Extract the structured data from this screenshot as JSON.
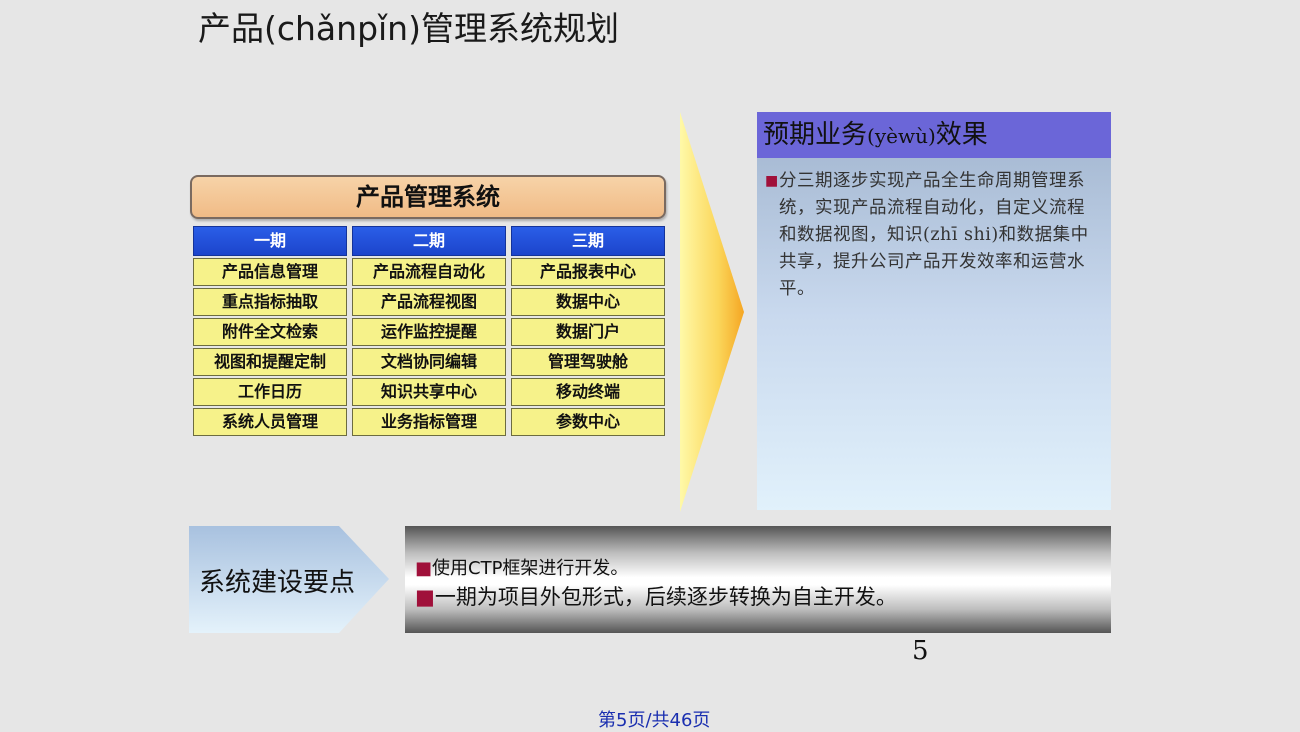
{
  "slide": {
    "title": "产品(chǎnpǐn)管理系统规划",
    "page_number": "5",
    "footer": "第5页/共46页"
  },
  "product_system": {
    "title": "产品管理系统",
    "phases": [
      {
        "name": "一期",
        "items": [
          "产品信息管理",
          "重点指标抽取",
          "附件全文检索",
          "视图和提醒定制",
          "工作日历",
          "系统人员管理"
        ]
      },
      {
        "name": "二期",
        "items": [
          "产品流程自动化",
          "产品流程视图",
          "运作监控提醒",
          "文档协同编辑",
          "知识共享中心",
          "业务指标管理"
        ]
      },
      {
        "name": "三期",
        "items": [
          "产品报表中心",
          "数据中心",
          "数据门户",
          "管理驾驶舱",
          "移动终端",
          "参数中心"
        ]
      }
    ]
  },
  "effect": {
    "title_main": "预期业务",
    "title_pinyin": "(yèwù)",
    "title_tail": "效果",
    "bullet": "■",
    "body": "分三期逐步实现产品全生命周期管理系统，实现产品流程自动化，自定义流程和数据视图，知识(zhī shi)和数据集中共享，提升公司产品开发效率和运营水平。"
  },
  "key_points": {
    "label": "系统建设要点",
    "bullet": "■",
    "items": [
      "使用CTP框架进行开发。",
      "一期为项目外包形式，后续逐步转换为自主开发。"
    ]
  },
  "colors": {
    "phase_header": "#1c44cc",
    "phase_item": "#f6f28a",
    "effect_header": "#6b66d8",
    "bullet": "#a0103a",
    "footer": "#1a2fb0"
  }
}
